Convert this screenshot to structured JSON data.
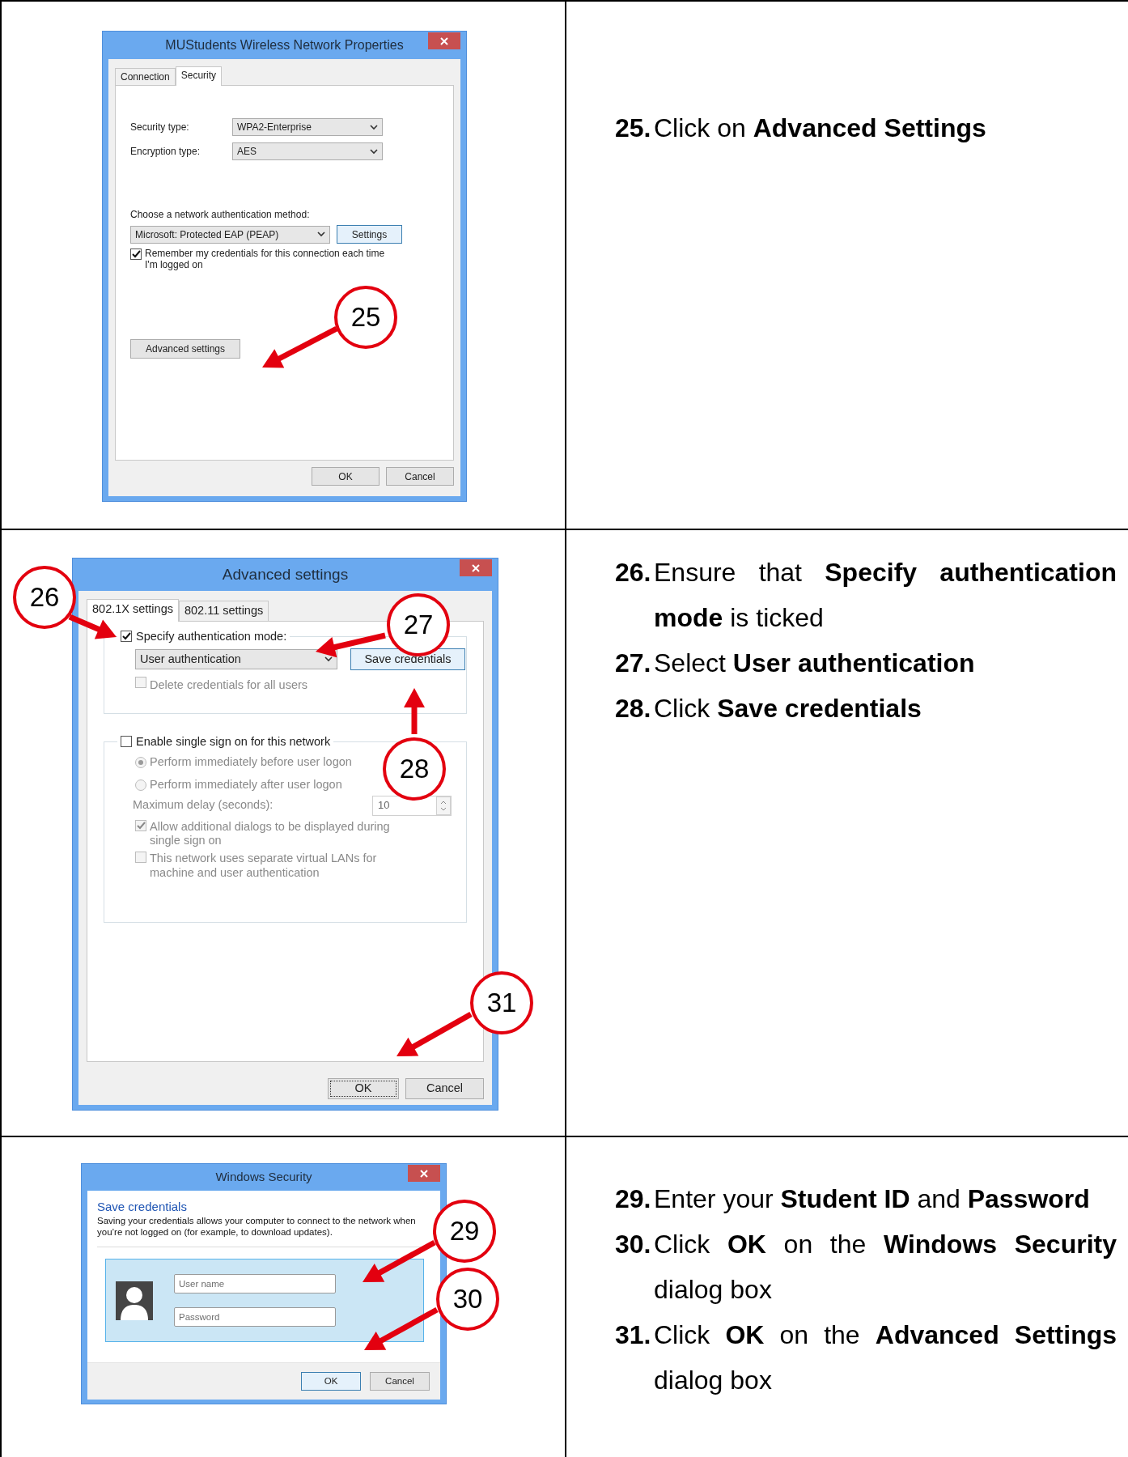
{
  "steps": [
    {
      "screenshot": {
        "kind": "network_properties",
        "title": "MUStudents Wireless Network Properties",
        "tabs": [
          {
            "label": "Connection",
            "selected": false
          },
          {
            "label": "Security",
            "selected": true
          }
        ],
        "fields": [
          {
            "label": "Security type:",
            "value": "WPA2-Enterprise"
          },
          {
            "label": "Encryption type:",
            "value": "AES"
          }
        ],
        "method_label": "Choose a network authentication method:",
        "method_value": "Microsoft: Protected EAP (PEAP)",
        "settings_button": "Settings",
        "remember": {
          "label": "Remember my credentials for this connection each time I'm logged on",
          "checked": true
        },
        "advanced_button": "Advanced settings",
        "buttons": [
          "OK",
          "Cancel"
        ],
        "callouts": [
          {
            "number": "25"
          }
        ]
      },
      "instructions": [
        {
          "number": "25.",
          "text": "Click on **Advanced Settings**"
        }
      ]
    },
    {
      "screenshot": {
        "kind": "advanced_settings",
        "title": "Advanced settings",
        "tabs": [
          {
            "label": "802.1X settings",
            "selected": true
          },
          {
            "label": "802.11 settings",
            "selected": false
          }
        ],
        "specify": {
          "label": "Specify authentication mode:",
          "checked": true
        },
        "mode_value": "User authentication",
        "save_button": "Save credentials",
        "delete_credentials": {
          "label": "Delete credentials for all users",
          "checked": false,
          "disabled": true
        },
        "sso": {
          "label": "Enable single sign on for this network",
          "checked": false
        },
        "sso_options": [
          {
            "label": "Perform immediately before user logon",
            "selected": true,
            "disabled": true
          },
          {
            "label": "Perform immediately after user logon",
            "selected": false,
            "disabled": true
          }
        ],
        "delay_label": "Maximum delay (seconds):",
        "delay_value": "10",
        "checks": [
          {
            "label": "Allow additional dialogs to be displayed during single sign on",
            "checked": true,
            "disabled": true
          },
          {
            "label": "This network uses separate virtual LANs for machine and user authentication",
            "checked": false,
            "disabled": true
          }
        ],
        "buttons": [
          "OK",
          "Cancel"
        ],
        "callouts": [
          {
            "number": "26"
          },
          {
            "number": "27"
          },
          {
            "number": "28"
          },
          {
            "number": "31"
          }
        ]
      },
      "instructions": [
        {
          "number": "26.",
          "text": "Ensure that **Specify authentication mode** is ticked"
        },
        {
          "number": "27.",
          "text": "Select **User authentication**"
        },
        {
          "number": "28.",
          "text": "Click **Save credentials**"
        }
      ]
    },
    {
      "screenshot": {
        "kind": "windows_security",
        "title": "Windows Security",
        "heading": "Save credentials",
        "description": "Saving your credentials allows your computer to connect to the network when you’re not logged on (for example, to download updates).",
        "fields": [
          {
            "placeholder": "User name"
          },
          {
            "placeholder": "Password"
          }
        ],
        "buttons": [
          "OK",
          "Cancel"
        ],
        "callouts": [
          {
            "number": "29"
          },
          {
            "number": "30"
          }
        ]
      },
      "instructions": [
        {
          "number": "29.",
          "text": "Enter your **Student ID** and **Password**"
        },
        {
          "number": "30.",
          "text": "Click **OK** on the **Windows Security** dialog box"
        },
        {
          "number": "31.",
          "text": "Click **OK** on the **Advanced Settings** dialog box"
        }
      ]
    }
  ]
}
